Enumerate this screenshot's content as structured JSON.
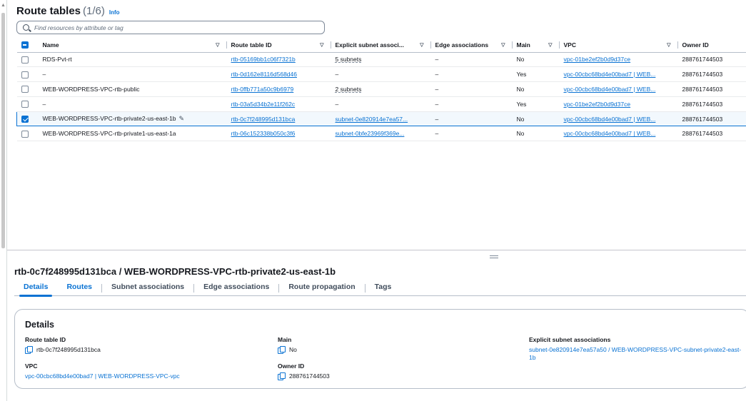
{
  "route_tables": {
    "title": "Route tables",
    "count": "(1/6)",
    "info": "Info",
    "search_placeholder": "Find resources by attribute or tag",
    "columns": [
      "Name",
      "Route table ID",
      "Explicit subnet associ...",
      "Edge associations",
      "Main",
      "VPC",
      "Owner ID"
    ],
    "rows": [
      {
        "name": "RDS-Pvt-rt",
        "id": "rtb-05169bb1c06f7321b",
        "subnet": "5 subnets",
        "edge": "–",
        "main": "No",
        "vpc": "vpc-01be2ef2b0d9d37ce",
        "owner": "288761744503",
        "selected": false
      },
      {
        "name": "–",
        "id": "rtb-0d162e8116d568d46",
        "subnet": "–",
        "edge": "–",
        "main": "Yes",
        "vpc": "vpc-00cbc68bd4e00bad7 | WEB...",
        "owner": "288761744503",
        "selected": false
      },
      {
        "name": "WEB-WORDPRESS-VPC-rtb-public",
        "id": "rtb-0ffb771a50c9b6979",
        "subnet": "2 subnets",
        "edge": "–",
        "main": "No",
        "vpc": "vpc-00cbc68bd4e00bad7 | WEB...",
        "owner": "288761744503",
        "selected": false
      },
      {
        "name": "–",
        "id": "rtb-03a5d34b2e11f262c",
        "subnet": "–",
        "edge": "–",
        "main": "Yes",
        "vpc": "vpc-01be2ef2b0d9d37ce",
        "owner": "288761744503",
        "selected": false
      },
      {
        "name": "WEB-WORDPRESS-VPC-rtb-private2-us-east-1b",
        "id": "rtb-0c7f248995d131bca",
        "subnet": "subnet-0e820914e7ea57...",
        "edge": "–",
        "main": "No",
        "vpc": "vpc-00cbc68bd4e00bad7 | WEB...",
        "owner": "288761744503",
        "selected": true
      },
      {
        "name": "WEB-WORDPRESS-VPC-rtb-private1-us-east-1a",
        "id": "rtb-06c152338b050c3f6",
        "subnet": "subnet-0bfe23969f369e...",
        "edge": "–",
        "main": "No",
        "vpc": "vpc-00cbc68bd4e00bad7 | WEB...",
        "owner": "288761744503",
        "selected": false
      }
    ]
  },
  "detail": {
    "heading": "rtb-0c7f248995d131bca / WEB-WORDPRESS-VPC-rtb-private2-us-east-1b",
    "tabs": [
      "Details",
      "Routes",
      "Subnet associations",
      "Edge associations",
      "Route propagation",
      "Tags"
    ],
    "active_tab": "Details",
    "card_title": "Details",
    "route_table_id_label": "Route table ID",
    "route_table_id": "rtb-0c7f248995d131bca",
    "main_label": "Main",
    "main": "No",
    "explicit_label": "Explicit subnet associations",
    "explicit_value": "subnet-0e820914e7ea57a50 / WEB-WORDPRESS-VPC-subnet-private2-east-1b",
    "vpc_label": "VPC",
    "vpc": "vpc-00cbc68bd4e00bad7 | WEB-WORDPRESS-VPC-vpc",
    "owner_label": "Owner ID",
    "owner": "288761744503"
  },
  "colors": {
    "accent": "#0972d3",
    "text": "#16191f",
    "border": "#b6bec9"
  },
  "icons": [
    "search-icon",
    "checkbox-icon",
    "sort-down-icon",
    "pencil-icon",
    "copy-icon",
    "drag-handle-icon"
  ]
}
